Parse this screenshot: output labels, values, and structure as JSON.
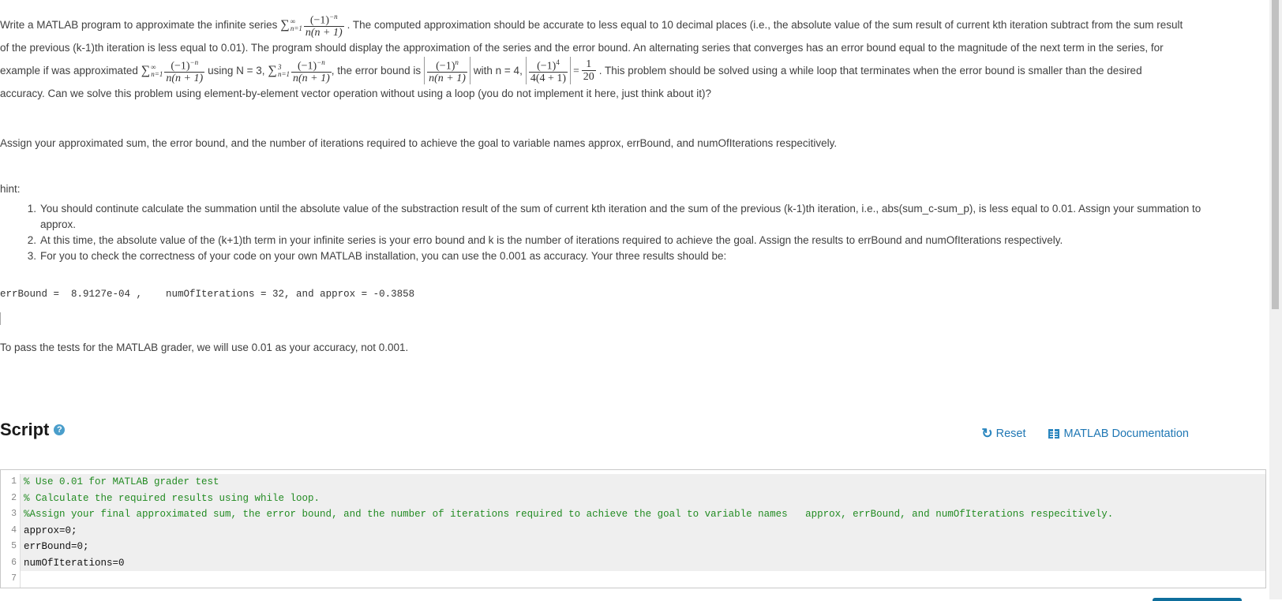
{
  "problem": {
    "line1_before": "Write a MATLAB program to approximate the infinite series",
    "line1_after": ". The computed approximation should be accurate to less equal to 10 decimal places (i.e., the absolute value of the sum result of current kth iteration subtract from the sum result",
    "line2": "of the previous (k-1)th iteration is less equal to 0.01). The program should display the approximation of the series and the error bound. An alternating series that converges has an error bound equal to the magnitude of the next term in the series, for",
    "line3_a": "example if  was approximated",
    "line3_b": "using N = 3,",
    "line3_c": ", the error bound is",
    "line3_d": "with n  = 4,",
    "line3_e": ". This problem should be solved using a while loop that terminates when the error bound is smaller than the desired",
    "line4": "accuracy. Can we solve this problem using element-by-element vector operation without using a loop (you do not implement it here, just think about it)?",
    "math": {
      "sum_symbol": "∑",
      "upper_inf": "∞",
      "upper_3": "3",
      "lower": "n=1",
      "num_neg": "(−1)",
      "exp_neg": "−n",
      "exp_n": "n",
      "den_n": "n(n + 1)",
      "num_4": "(−1)",
      "exp_4": "4",
      "den_4": "4(4 + 1)",
      "eq": "=",
      "result_num": "1",
      "result_den": "20"
    }
  },
  "assign_text": "Assign your approximated sum, the error bound, and the number of iterations required to achieve the goal to variable names   approx, errBound, and numOfIterations respecitively.",
  "hint_label": "hint:",
  "hints": [
    {
      "n": "1.",
      "text": "You should continute calculate the summation until the absolute value of the substraction result of the sum of current kth iteration and the sum of the previous (k-1)th iteration, i.e., abs(sum_c-sum_p), is less equal to 0.01. Assign your summation to approx."
    },
    {
      "n": "2.",
      "text": "At this time, the absolute value of the (k+1)th term in your infinite series is your erro bound and k is the number of iterations required to achieve the goal.   Assign the results to errBound and numOfIterations respectively."
    },
    {
      "n": "3.",
      "text": "For you to check the correctness of your code on your own MATLAB installation, you can use the 0.001 as accuracy. Your three results should be:"
    }
  ],
  "expected_results": "errBound =  8.9127e-04 ,    numOfIterations = 32, and approx = -0.3858",
  "pass_text": "To pass the tests for the MATLAB grader, we will use 0.01 as your accuracy, not 0.001.",
  "script": {
    "title": "Script",
    "help_icon": "?",
    "reset_label": "Reset",
    "reset_icon": "↻",
    "docs_label": "MATLAB Documentation",
    "accent_color": "#1f77b4"
  },
  "editor": {
    "lines": [
      {
        "num": "1",
        "text": "% Use 0.01 for MATLAB grader test",
        "comment": true
      },
      {
        "num": "2",
        "text": "% Calculate the required results using while loop.",
        "comment": true
      },
      {
        "num": "3",
        "text": "%Assign your final approximated sum, the error bound, and the number of iterations required to achieve the goal to variable names   approx, errBound, and numOfIterations respecitively.",
        "comment": true
      },
      {
        "num": "4",
        "text": "approx=0;",
        "comment": false
      },
      {
        "num": "5",
        "text": "errBound=0;",
        "comment": false
      },
      {
        "num": "6",
        "text": "numOfIterations=0",
        "comment": false
      },
      {
        "num": "7",
        "text": "",
        "comment": false
      }
    ]
  }
}
